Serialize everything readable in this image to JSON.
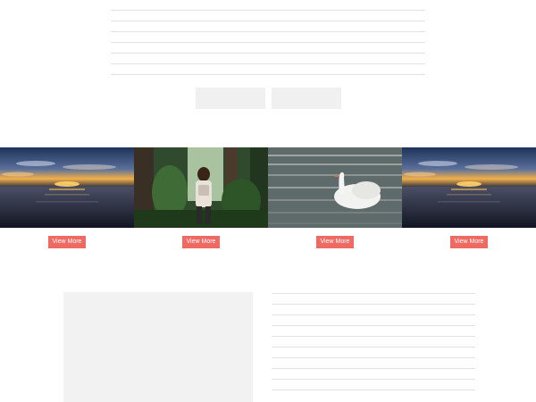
{
  "gallery": {
    "items": [
      {
        "image": "sunset-over-sea",
        "button_label": "View More"
      },
      {
        "image": "hiker-in-forest",
        "button_label": "View More"
      },
      {
        "image": "swan-on-water",
        "button_label": "View More"
      },
      {
        "image": "sunset-over-sea",
        "button_label": "View More"
      }
    ]
  },
  "colors": {
    "button": "#f06a64",
    "placeholder": "#f0f0f0",
    "line": "#e2e2e2"
  }
}
